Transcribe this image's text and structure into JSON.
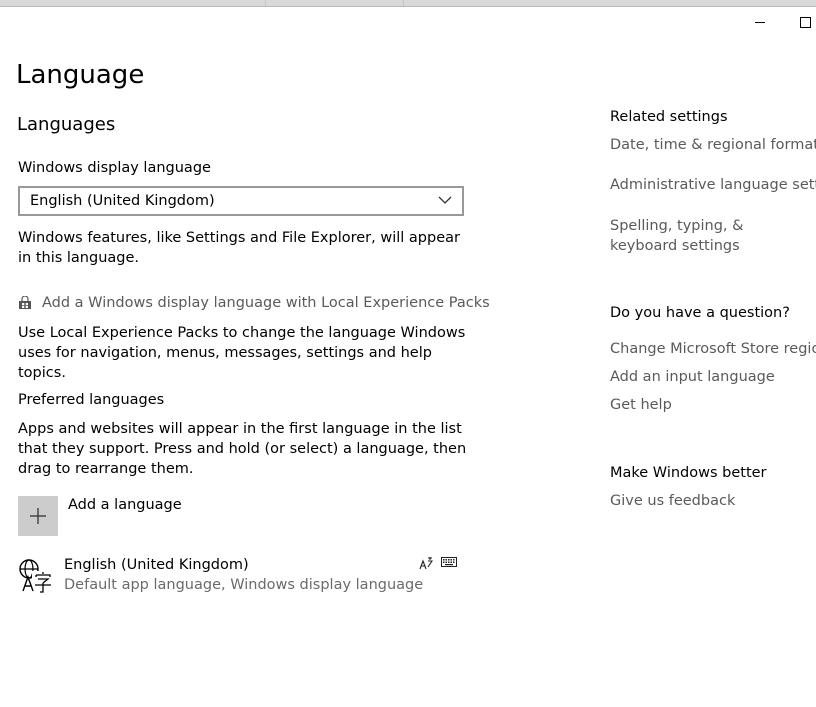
{
  "window": {
    "minimize_icon": "minimize-icon",
    "maximize_icon": "maximize-icon"
  },
  "page": {
    "title": "Language",
    "section_title": "Languages"
  },
  "display_language": {
    "label": "Windows display language",
    "selected": "English (United Kingdom)",
    "description": "Windows features, like Settings and File Explorer, will appear in this language."
  },
  "local_experience": {
    "link": "Add a Windows display language with Local Experience Packs",
    "icon": "store-icon",
    "description": "Use Local Experience Packs to change the language Windows uses for navigation, menus, messages, settings and help topics."
  },
  "preferred": {
    "label": "Preferred languages",
    "description": "Apps and websites will appear in the first language in the list that they support. Press and hold (or select) a language, then drag to rearrange them.",
    "add_label": "Add a language",
    "items": [
      {
        "name": "English (United Kingdom)",
        "subtitle": "Default app language, Windows display language",
        "icon": "language-icon",
        "feature_icons": [
          "text-to-speech-icon",
          "keyboard-icon"
        ]
      }
    ]
  },
  "related": {
    "heading": "Related settings",
    "links": [
      "Date, time & regional formatting",
      "Administrative language settings",
      "Spelling, typing, & keyboard settings"
    ]
  },
  "question": {
    "heading": "Do you have a question?",
    "links": [
      "Change Microsoft Store region",
      "Add an input language",
      "Get help"
    ]
  },
  "better": {
    "heading": "Make Windows better",
    "link": "Give us feedback"
  },
  "colors": {
    "button_grey": "#cccccc",
    "link_grey": "#5a5a5a",
    "border_grey": "#999999"
  }
}
